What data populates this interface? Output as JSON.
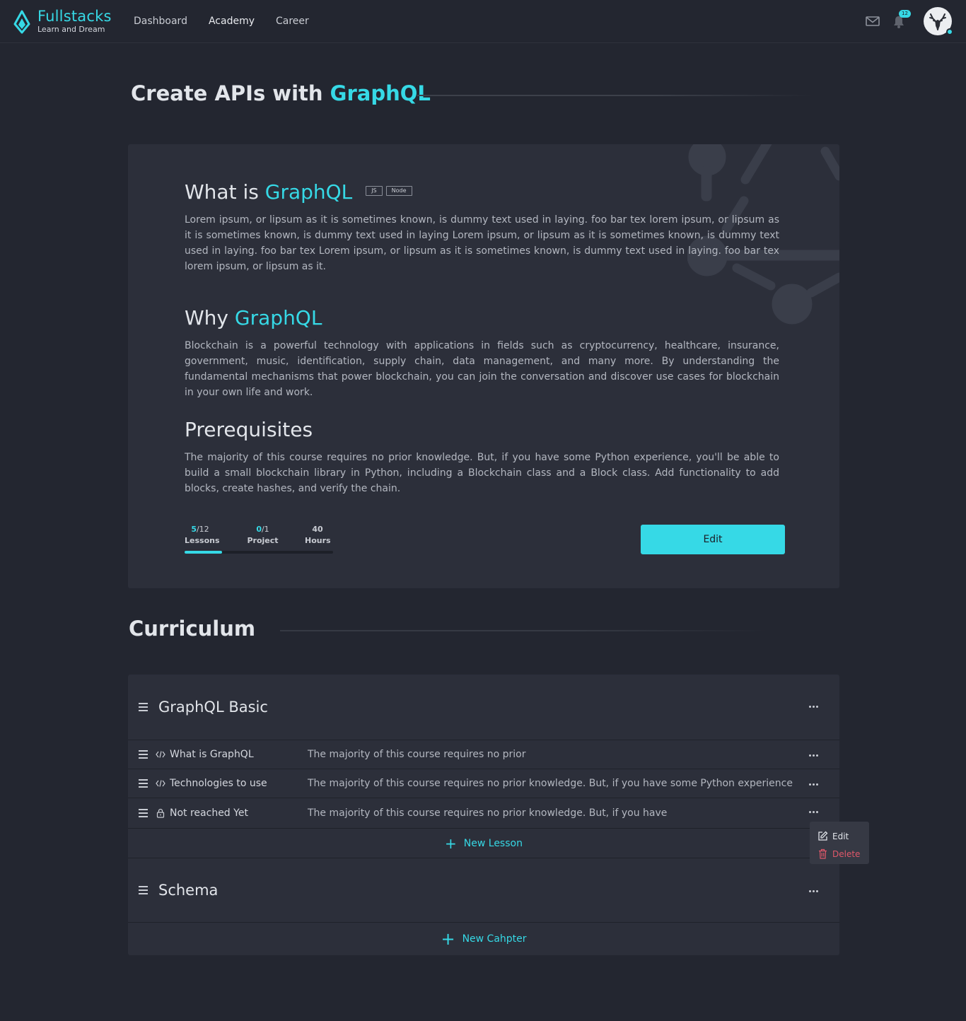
{
  "brand": {
    "name": "Fullstacks",
    "tagline": "Learn and Dream",
    "accent_color": "#36d9e6"
  },
  "nav": [
    {
      "label": "Dashboard",
      "active": false
    },
    {
      "label": "Academy",
      "active": true
    },
    {
      "label": "Career",
      "active": false
    }
  ],
  "header": {
    "notification_count": "12",
    "mail_icon": "mail-icon",
    "bell_icon": "bell-icon",
    "avatar_icon": "deer-avatar",
    "online": true
  },
  "page": {
    "title_prefix": "Create APIs with",
    "title_accent": "GraphQL"
  },
  "overview": {
    "what": {
      "heading_prefix": "What is",
      "heading_accent": "GraphQL",
      "tags": [
        "JS",
        "Node"
      ],
      "body": "Lorem ipsum, or lipsum as it is sometimes known, is dummy text used in laying. foo bar tex lorem ipsum, or lipsum as it is sometimes known, is dummy text used in laying Lorem ipsum, or lipsum as it is sometimes known, is dummy text used in laying. foo bar tex Lorem ipsum, or lipsum as it is sometimes known, is dummy text used in laying. foo bar tex lorem ipsum, or lipsum as it."
    },
    "why": {
      "heading_prefix": "Why",
      "heading_accent": "GraphQL",
      "body": "Blockchain is a powerful technology with applications in fields such as cryptocurrency, healthcare, insurance, government, music, identification, supply chain, data management, and many more. By understanding the fundamental mechanisms that power blockchain, you can join the conversation and discover use cases for blockchain in your own life and work."
    },
    "prereq": {
      "heading": "Prerequisites",
      "body": "The majority of this course requires no prior knowledge. But, if you have some Python experience, you'll be able to build a small blockchain library in Python, including a Blockchain class and a Block class. Add functionality to add blocks, create hashes, and verify the chain."
    },
    "stats": {
      "lessons": {
        "done": "5",
        "total": "/12",
        "label": "Lessons"
      },
      "project": {
        "done": "0",
        "total": "/1",
        "label": "Project"
      },
      "hours": {
        "value": "40",
        "label": "Hours"
      },
      "progress_fraction": 0.25
    },
    "edit_label": "Edit"
  },
  "curriculum": {
    "title": "Curriculum",
    "chapters": [
      {
        "title": "GraphQL Basic",
        "lessons": [
          {
            "icon": "code-icon",
            "name": "What is GraphQL",
            "desc": "The majority of this course requires no prior"
          },
          {
            "icon": "code-icon",
            "name": "Technologies to use",
            "desc": "The majority of this course requires no prior knowledge. But, if you have some Python experience"
          },
          {
            "icon": "lock-icon",
            "name": "Not reached Yet",
            "desc": "The majority of this course requires no prior knowledge. But, if you have"
          }
        ],
        "new_lesson_label": "New Lesson"
      },
      {
        "title": "Schema"
      }
    ],
    "new_chapter_label": "New Cahpter",
    "menu": {
      "edit_label": "Edit",
      "delete_label": "Delete",
      "delete_color": "#e0586a"
    }
  }
}
